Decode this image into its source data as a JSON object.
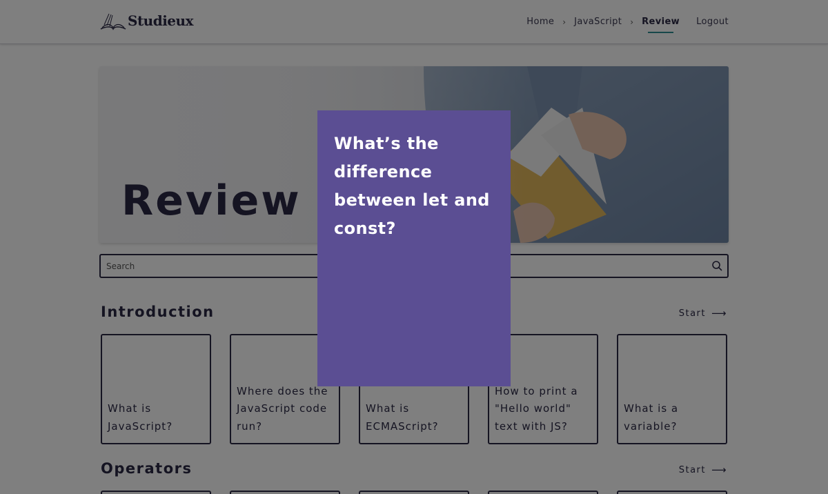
{
  "brand": {
    "name": "Studieux"
  },
  "nav": {
    "breadcrumbs": [
      {
        "label": "Home"
      },
      {
        "label": "JavaScript"
      },
      {
        "label": "Review"
      }
    ],
    "separator": "›",
    "logout_label": "Logout"
  },
  "hero": {
    "title": "Review"
  },
  "search": {
    "placeholder": "Search"
  },
  "sections": [
    {
      "title": "Introduction",
      "start_label": "Start",
      "cards": [
        "What is JavaScript?",
        "Where does the JavaScript code run?",
        "What is ECMAScript?",
        "How to print a \"Hello world\" text with JS?",
        "What is a variable?"
      ]
    },
    {
      "title": "Operators",
      "start_label": "Start",
      "cards": []
    }
  ],
  "flashcard": {
    "question": "What’s the difference between let and const?"
  },
  "colors": {
    "primary_text": "#2a2844",
    "accent_underline": "#2f8f95",
    "flashcard_bg": "#5b4e93",
    "overlay": "rgba(0,0,0,0.5)"
  }
}
